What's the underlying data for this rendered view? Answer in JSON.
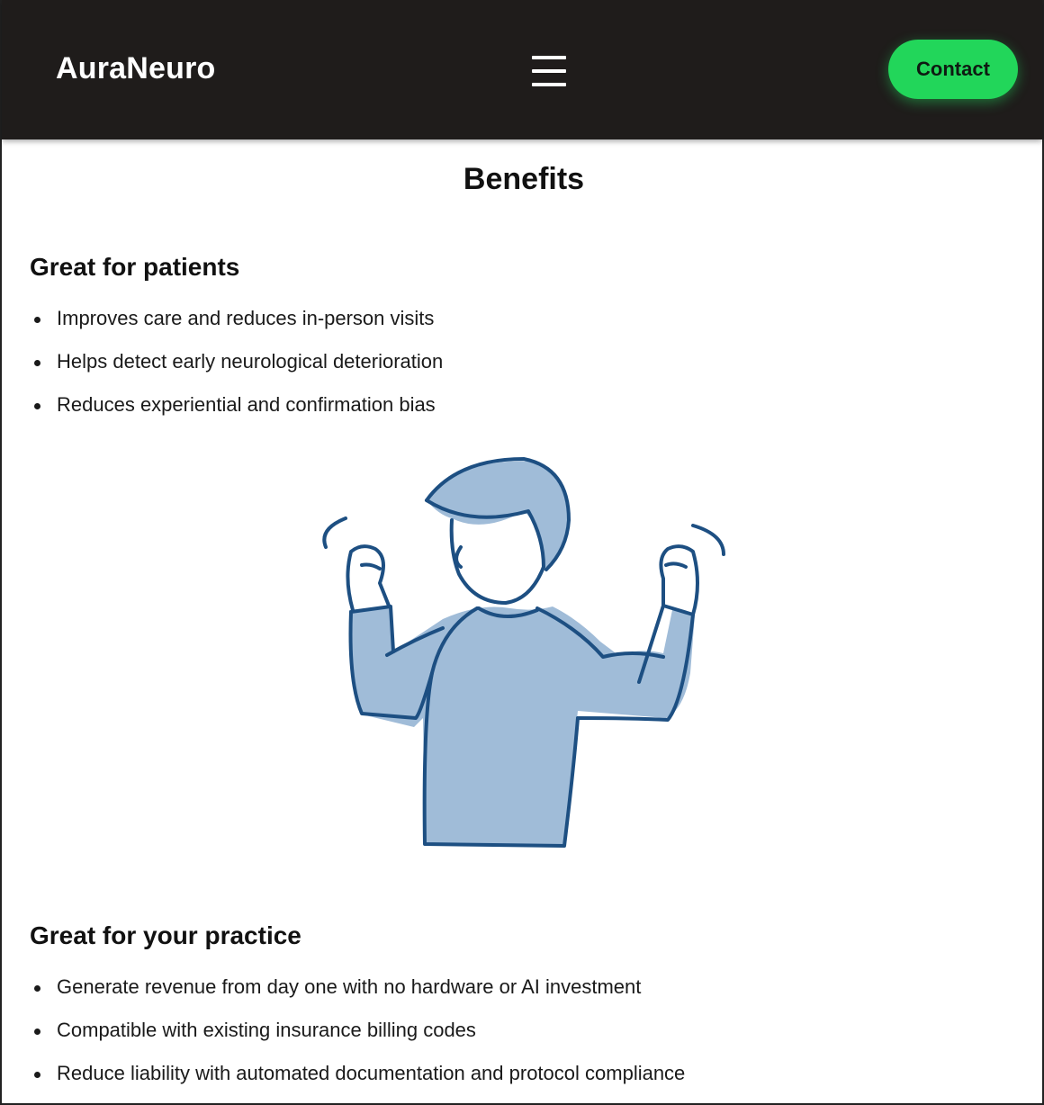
{
  "navbar": {
    "brand": "AuraNeuro",
    "menu_icon": "hamburger-menu-icon",
    "contact_label": "Contact",
    "colors": {
      "background": "#1f1c1b",
      "accent": "#22d65a"
    }
  },
  "main": {
    "title": "Benefits",
    "patients": {
      "heading": "Great for patients",
      "items": [
        "Improves care and reduces in-person visits",
        "Helps detect early neurological deterioration",
        "Reduces experiential and confirmation bias"
      ]
    },
    "illustration": {
      "icon": "flexing-person-illustration",
      "colors": {
        "fill": "#a0bcd8",
        "stroke": "#1d4f82"
      }
    },
    "practice": {
      "heading": "Great for your practice",
      "items": [
        "Generate revenue from day one with no hardware or AI investment",
        "Compatible with existing insurance billing codes",
        "Reduce liability with automated documentation and protocol compliance"
      ]
    }
  }
}
